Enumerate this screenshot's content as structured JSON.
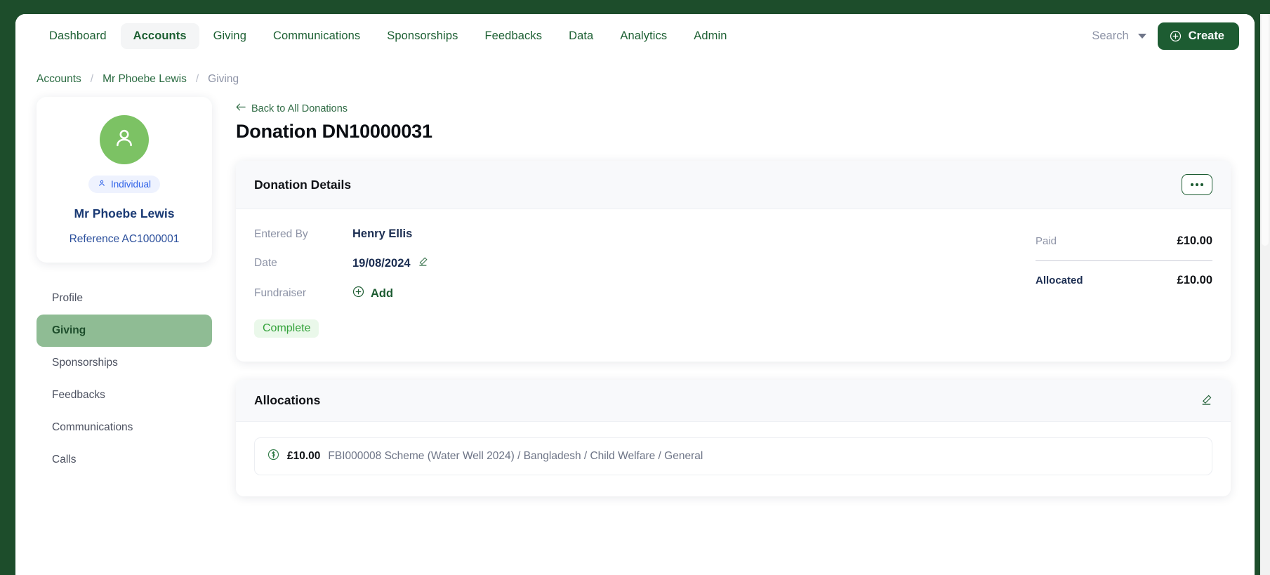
{
  "navbar": {
    "tabs": [
      {
        "label": "Dashboard",
        "active": false
      },
      {
        "label": "Accounts",
        "active": true
      },
      {
        "label": "Giving",
        "active": false
      },
      {
        "label": "Communications",
        "active": false
      },
      {
        "label": "Sponsorships",
        "active": false
      },
      {
        "label": "Feedbacks",
        "active": false
      },
      {
        "label": "Data",
        "active": false
      },
      {
        "label": "Analytics",
        "active": false
      },
      {
        "label": "Admin",
        "active": false
      }
    ],
    "search_label": "Search",
    "create_label": "Create",
    "create_icon": "plus-circle-icon",
    "caret_icon": "chevron-down-icon"
  },
  "breadcrumb": {
    "items": [
      "Accounts",
      "Mr Phoebe Lewis",
      "Giving"
    ],
    "separator": "/"
  },
  "profile": {
    "avatar_icon": "person-icon",
    "badge_icon": "person-small-icon",
    "badge_label": "Individual",
    "name": "Mr Phoebe Lewis",
    "reference_label": "Reference",
    "reference_value": "AC1000001"
  },
  "sidebar": {
    "items": [
      {
        "label": "Profile",
        "active": false
      },
      {
        "label": "Giving",
        "active": true
      },
      {
        "label": "Sponsorships",
        "active": false
      },
      {
        "label": "Feedbacks",
        "active": false
      },
      {
        "label": "Communications",
        "active": false
      },
      {
        "label": "Calls",
        "active": false
      }
    ]
  },
  "main": {
    "back_link": "Back to All Donations",
    "back_icon": "arrow-left-icon",
    "title": "Donation DN10000031",
    "details": {
      "card_title": "Donation Details",
      "overflow_icon": "ellipsis-icon",
      "entered_by_label": "Entered By",
      "entered_by_value": "Henry Ellis",
      "date_label": "Date",
      "date_value": "19/08/2024",
      "date_edit_icon": "pencil-icon",
      "fundraiser_label": "Fundraiser",
      "fundraiser_add_label": "Add",
      "fundraiser_add_icon": "plus-circle-icon",
      "status": "Complete"
    },
    "totals": {
      "paid_label": "Paid",
      "paid_value": "£10.00",
      "allocated_label": "Allocated",
      "allocated_value": "£10.00"
    },
    "allocations": {
      "card_title": "Allocations",
      "edit_icon": "pencil-icon",
      "rows": [
        {
          "icon": "dollar-circle-icon",
          "amount": "£10.00",
          "description": "FBI000008 Scheme (Water Well 2024) / Bangladesh / Child Welfare / General"
        }
      ]
    }
  },
  "colors": {
    "brand_dark_green": "#1d4d2b",
    "brand_green": "#1d5c32",
    "avatar_green": "#7cc264",
    "active_nav_green": "#8fbc94",
    "status_green": "#33a23a",
    "badge_blue": "#2f62e8",
    "navy_text": "#1a3a74"
  }
}
